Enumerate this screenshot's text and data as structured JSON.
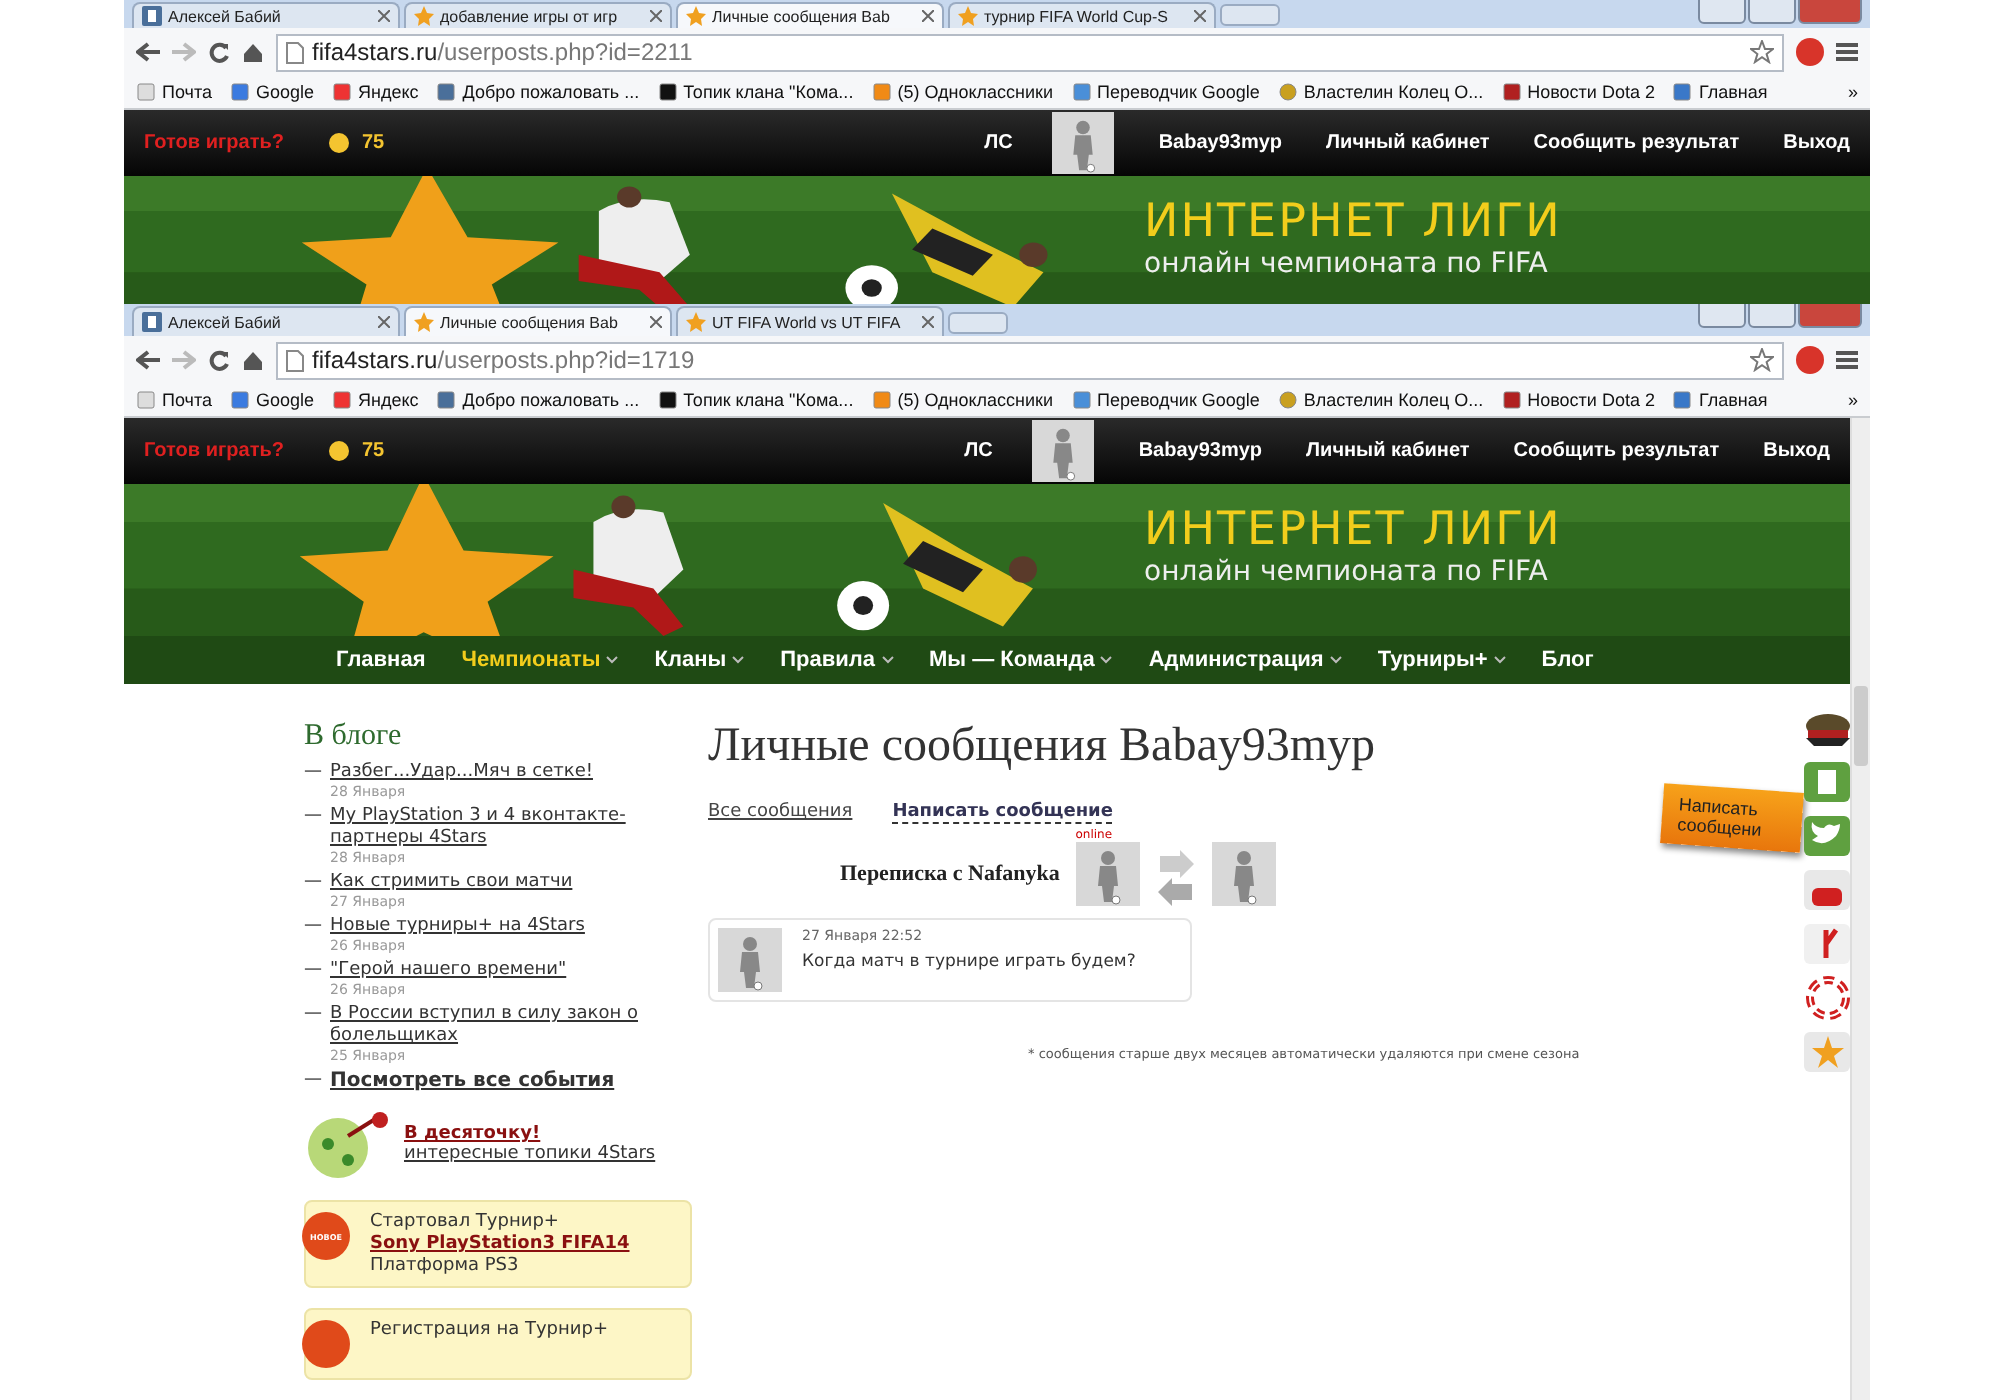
{
  "windows": [
    {
      "tabs": [
        {
          "label": "Алексей Бабий",
          "kind": "vk",
          "selected": false
        },
        {
          "label": "добавление игры от игр",
          "kind": "star",
          "selected": false
        },
        {
          "label": "Личные сообщения Bab",
          "kind": "star",
          "selected": true
        },
        {
          "label": "турнир FIFA World Cup-S",
          "kind": "star",
          "selected": false
        }
      ],
      "address": {
        "host": "fifa4stars.ru",
        "path": "/userposts.php?id=2211"
      },
      "bookmarks": [
        {
          "label": "Почта",
          "kind": "page"
        },
        {
          "label": "Google",
          "kind": "google"
        },
        {
          "label": "Яндекс",
          "kind": "yandex"
        },
        {
          "label": "Добро пожаловать ...",
          "kind": "vk"
        },
        {
          "label": "Топик клана \"Кома...",
          "kind": "dark"
        },
        {
          "label": "(5) Одноклассники",
          "kind": "ok"
        },
        {
          "label": "Переводчик Google",
          "kind": "translate"
        },
        {
          "label": "Властелин Колец О...",
          "kind": "ring"
        },
        {
          "label": "Новости Dota 2",
          "kind": "dota"
        },
        {
          "label": "Главная",
          "kind": "bird"
        }
      ],
      "more": "»",
      "topbar": {
        "prompt": "Готов играть?",
        "coins": "75",
        "messages": "ЛС",
        "username": "Babay93myp",
        "links": [
          "Личный кабинет",
          "Сообщить результат",
          "Выход"
        ]
      },
      "banner": {
        "headline": "ИНТЕРНЕТ ЛИГИ",
        "subline": "онлайн чемпионата по FIFA"
      }
    },
    {
      "tabs": [
        {
          "label": "Алексей Бабий",
          "kind": "vk",
          "selected": false
        },
        {
          "label": "Личные сообщения Bab",
          "kind": "star",
          "selected": true
        },
        {
          "label": "UT FIFA World vs UT FIFA",
          "kind": "star",
          "selected": false
        }
      ],
      "address": {
        "host": "fifa4stars.ru",
        "path": "/userposts.php?id=1719"
      },
      "bookmarks": [
        {
          "label": "Почта",
          "kind": "page"
        },
        {
          "label": "Google",
          "kind": "google"
        },
        {
          "label": "Яндекс",
          "kind": "yandex"
        },
        {
          "label": "Добро пожаловать ...",
          "kind": "vk"
        },
        {
          "label": "Топик клана \"Кома...",
          "kind": "dark"
        },
        {
          "label": "(5) Одноклассники",
          "kind": "ok"
        },
        {
          "label": "Переводчик Google",
          "kind": "translate"
        },
        {
          "label": "Властелин Колец О...",
          "kind": "ring"
        },
        {
          "label": "Новости Dota 2",
          "kind": "dota"
        },
        {
          "label": "Главная",
          "kind": "bird"
        }
      ],
      "more": "»",
      "topbar": {
        "prompt": "Готов играть?",
        "coins": "75",
        "messages": "ЛС",
        "username": "Babay93myp",
        "links": [
          "Личный кабинет",
          "Сообщить результат",
          "Выход"
        ]
      },
      "banner": {
        "headline": "ИНТЕРНЕТ ЛИГИ",
        "subline": "онлайн чемпионата по FIFA"
      },
      "nav": [
        {
          "label": "Главная",
          "selected": false,
          "has_menu": false
        },
        {
          "label": "Чемпионаты",
          "selected": true,
          "has_menu": true
        },
        {
          "label": "Кланы",
          "selected": false,
          "has_menu": true
        },
        {
          "label": "Правила",
          "selected": false,
          "has_menu": true
        },
        {
          "label": "Мы — Команда",
          "selected": false,
          "has_menu": true
        },
        {
          "label": "Администрация",
          "selected": false,
          "has_menu": true
        },
        {
          "label": "Турниры+",
          "selected": false,
          "has_menu": true
        },
        {
          "label": "Блог",
          "selected": false,
          "has_menu": false
        }
      ],
      "content": {
        "blog": {
          "title": "В блоге",
          "posts": [
            {
              "bullet": "—",
              "title": "Разбег...Удар...Мяч в сетке!",
              "date": "28 Января"
            },
            {
              "bullet": "—",
              "title": "My PlayStation 3 и 4 вконтакте-партнеры 4Stars",
              "date": "28 Января"
            },
            {
              "bullet": "—",
              "title": "Как стримить свои матчи",
              "date": "27 Января"
            },
            {
              "bullet": "—",
              "title": "Новые турниры+ на 4Stars",
              "date": "26 Января"
            },
            {
              "bullet": "—",
              "title": "\"Герой нашего времени\"",
              "date": "26 Января"
            },
            {
              "bullet": "—",
              "title": "В России вступил в силу закон о болельщиках",
              "date": "25 Января"
            }
          ],
          "all_link": {
            "bullet": "—",
            "label": "Посмотреть все события"
          }
        },
        "promo": {
          "title": "В десяточку!",
          "subtitle": "интересные топики 4Stars"
        },
        "announcements": [
          {
            "badge": "НОВОЕ",
            "lead": "Стартовал Турнир+",
            "link": "Sony PlayStation3 FIFA14",
            "platform": "Платформа PS3"
          },
          {
            "lead": "Регистрация на Турнир+"
          }
        ],
        "title": "Личные сообщения Babay93myp",
        "tabs": [
          {
            "label": "Все сообщения",
            "selected": false
          },
          {
            "label": "Написать сообщение",
            "selected": true
          }
        ],
        "conversation": {
          "label": "Переписка с Nafanyka",
          "status": "online"
        },
        "messages": [
          {
            "time": "27 Января 22:52",
            "text": "Когда матч в турнире играть будем?"
          }
        ],
        "note": "* сообщения старше двух месяцев автоматически удаляются при смене сезона",
        "feedback": "Написать сообщени",
        "social": [
          {
            "kind": "cap"
          },
          {
            "kind": "vk"
          },
          {
            "kind": "twitter"
          },
          {
            "kind": "youtube"
          },
          {
            "kind": "yandex"
          },
          {
            "kind": "lifebuoy"
          },
          {
            "kind": "star"
          }
        ]
      }
    }
  ]
}
